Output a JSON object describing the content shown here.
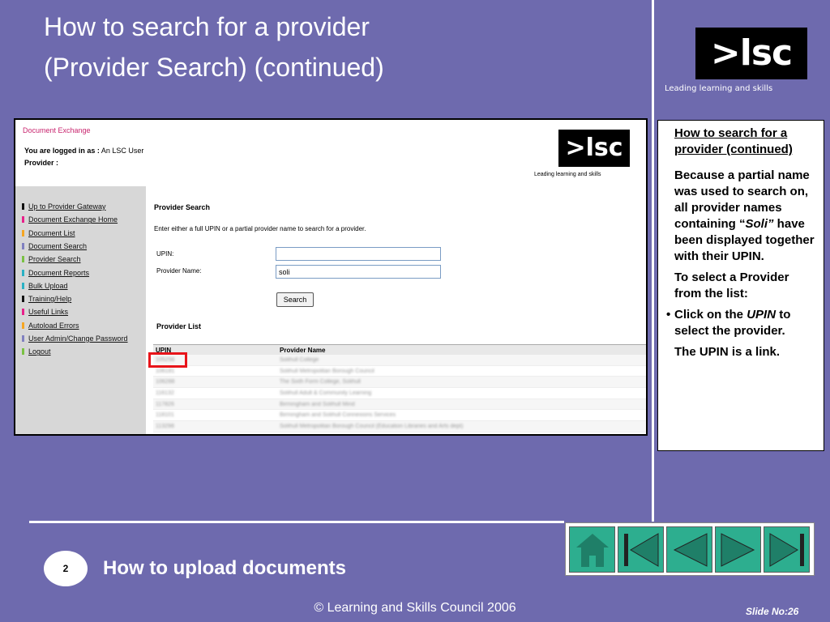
{
  "slide": {
    "title_line1": "How to search for a provider",
    "title_line2": "(Provider Search) (continued)",
    "logo_text": ">lsc",
    "logo_tagline": "Leading learning and skills",
    "section_number": "2",
    "section_title": "How to upload documents",
    "copyright": "© Learning and Skills Council 2006",
    "slide_no": "Slide No:26"
  },
  "screenshot": {
    "app_title": "Document Exchange",
    "logged_in_label": "You are logged in as :",
    "logged_in_user": "An LSC User",
    "provider_label": "Provider :",
    "logo_text": ">lsc",
    "logo_tagline": "Leading learning and skills",
    "nav_items": [
      {
        "label": "Up to Provider Gateway",
        "color": "#111111"
      },
      {
        "label": "Document Exchange Home",
        "color": "#e8208a"
      },
      {
        "label": "Document List",
        "color": "#f5a623"
      },
      {
        "label": "Document Search",
        "color": "#8080c0"
      },
      {
        "label": "Provider Search",
        "color": "#7ac143"
      },
      {
        "label": "Document Reports",
        "color": "#2ab1c4"
      },
      {
        "label": "Bulk Upload",
        "color": "#2ab1c4"
      },
      {
        "label": "Training/Help",
        "color": "#111111"
      },
      {
        "label": "Useful Links",
        "color": "#e8208a"
      },
      {
        "label": "Autoload Errors",
        "color": "#f5a623"
      },
      {
        "label": "User Admin/Change Password",
        "color": "#8080c0"
      },
      {
        "label": "Logout",
        "color": "#7ac143"
      }
    ],
    "search_heading": "Provider Search",
    "search_description": "Enter either a full UPIN or a partial provider name to search for a provider.",
    "upin_label": "UPIN:",
    "upin_value": "",
    "name_label": "Provider Name:",
    "name_value": "soli",
    "search_button": "Search",
    "list_heading": "Provider List",
    "table_headers": {
      "upin": "UPIN",
      "name": "Provider Name"
    },
    "table_rows": [
      {
        "upin": "105256",
        "name": "Solihull College"
      },
      {
        "upin": "106181",
        "name": "Solihull Metropolitan Borough Council"
      },
      {
        "upin": "106288",
        "name": "The Sixth Form College, Solihull"
      },
      {
        "upin": "116132",
        "name": "Solihull Adult & Community Learning"
      },
      {
        "upin": "117826",
        "name": "Birmingham and Solihull Mind"
      },
      {
        "upin": "118101",
        "name": "Birmingham and Solihull Connexions Services"
      },
      {
        "upin": "113298",
        "name": "Solihull Metropolitan Borough Council (Education Libraries and Arts dept)"
      }
    ]
  },
  "note": {
    "title": "How to search for a provider (continued)",
    "para1_pre": "Because a partial name was used to search on, all provider  names containing “",
    "para1_em": "Soli”",
    "para1_post": " have been displayed together with their UPIN.",
    "para2": "To select a Provider from the list:",
    "bullet_pre": "Click on  the ",
    "bullet_em": "UPIN",
    "bullet_post": " to select the provider.",
    "para3": "The UPIN is a link."
  },
  "nav_buttons": [
    {
      "icon": "home-icon"
    },
    {
      "icon": "first-slide-icon"
    },
    {
      "icon": "previous-slide-icon"
    },
    {
      "icon": "next-slide-icon"
    },
    {
      "icon": "last-slide-icon"
    }
  ],
  "colors": {
    "background": "#6e6aae",
    "nav_button": "#2dae8f",
    "highlight": "#e8141a"
  }
}
